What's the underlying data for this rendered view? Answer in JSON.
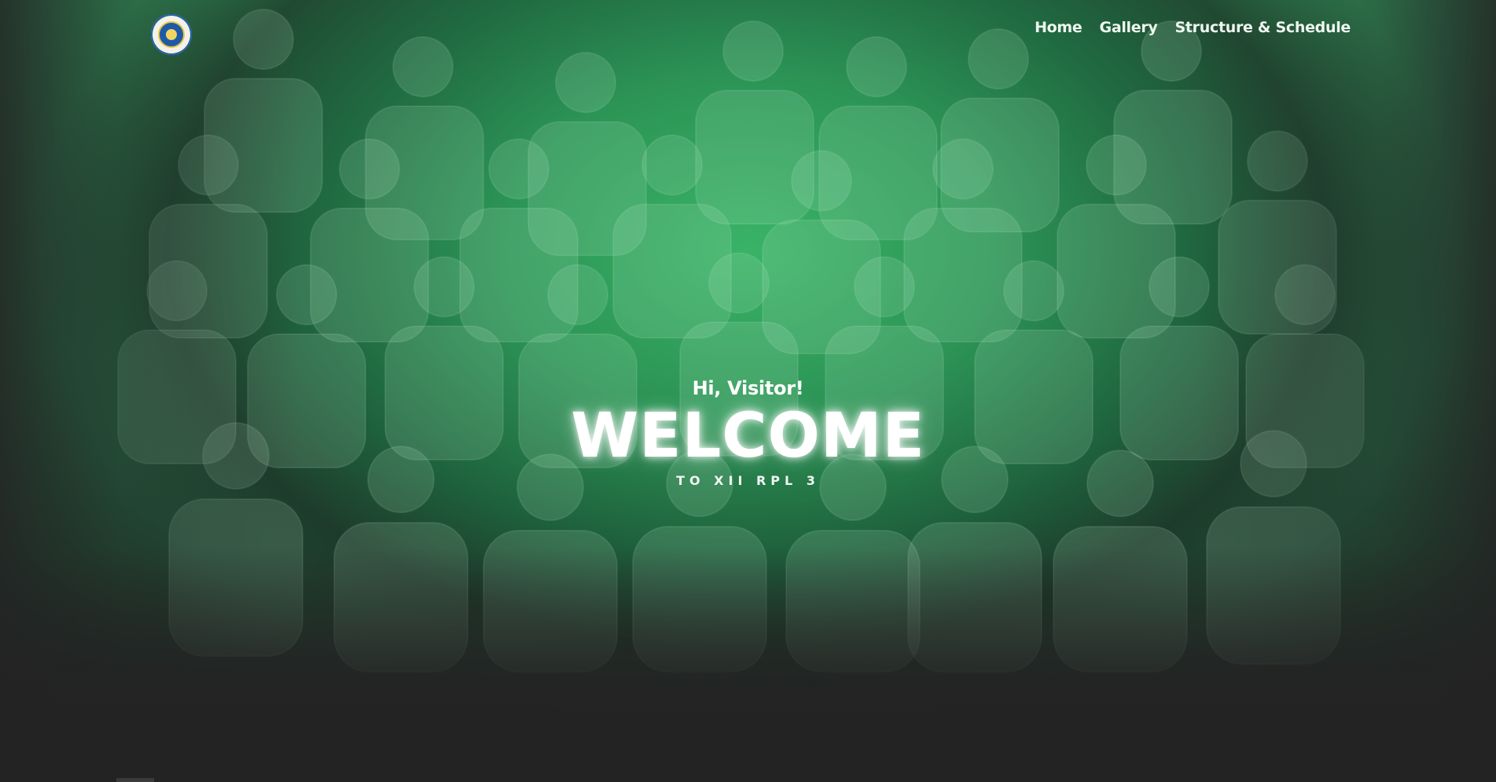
{
  "navbar": {
    "logo": "school-emblem",
    "links": [
      {
        "label": "Home"
      },
      {
        "label": "Gallery"
      },
      {
        "label": "Structure & Schedule"
      }
    ]
  },
  "hero": {
    "greeting": "Hi, Visitor!",
    "headline": "WELCOME",
    "subheadline": "TO XII RPL 3"
  },
  "colors": {
    "overlay_green": "#2f8c56",
    "background_dark": "#232323",
    "text": "#ffffff"
  }
}
